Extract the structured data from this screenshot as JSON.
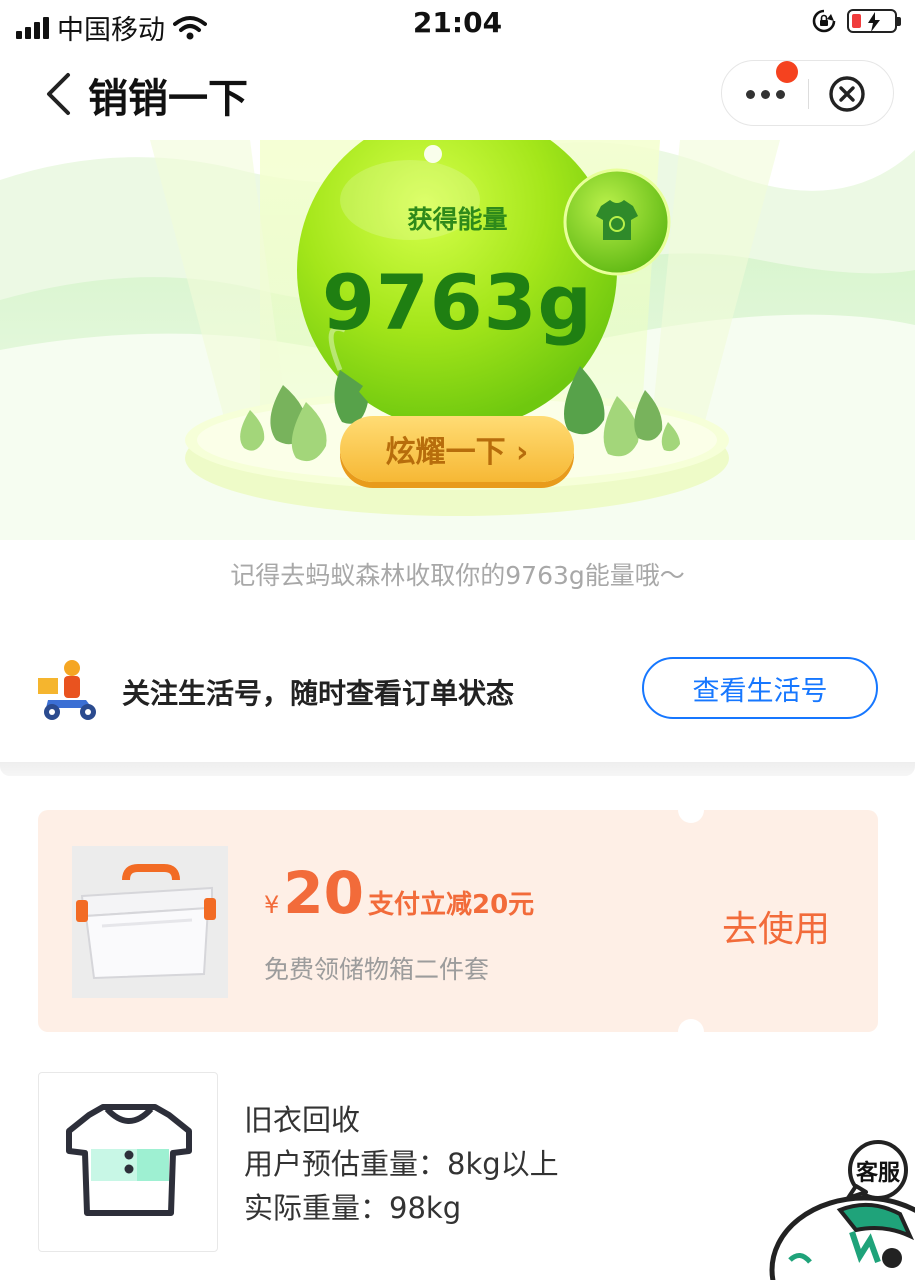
{
  "status_bar": {
    "carrier": "中国移动",
    "time": "21:04"
  },
  "nav": {
    "title": "销销一下"
  },
  "hero": {
    "energy_label": "获得能量",
    "energy_value": "9763g",
    "show_button": "炫耀一下 ›",
    "reminder": "记得去蚂蚁森林收取你的9763g能量哦～"
  },
  "follow": {
    "text": "关注生活号，随时查看订单状态",
    "button": "查看生活号"
  },
  "coupon": {
    "currency": "¥",
    "amount": "20",
    "desc": "支付立减20元",
    "subtitle": "免费领储物箱二件套",
    "use_button": "去使用"
  },
  "order": {
    "title": "旧衣回收",
    "estimated": "用户预估重量：8kg以上",
    "actual": "实际重量：98kg"
  },
  "service": {
    "label": "客服"
  },
  "colors": {
    "accent_blue": "#1677ff",
    "coupon_orange": "#f26b3a",
    "energy_green": "#1f7f12",
    "coupon_bg": "#feefe6"
  }
}
